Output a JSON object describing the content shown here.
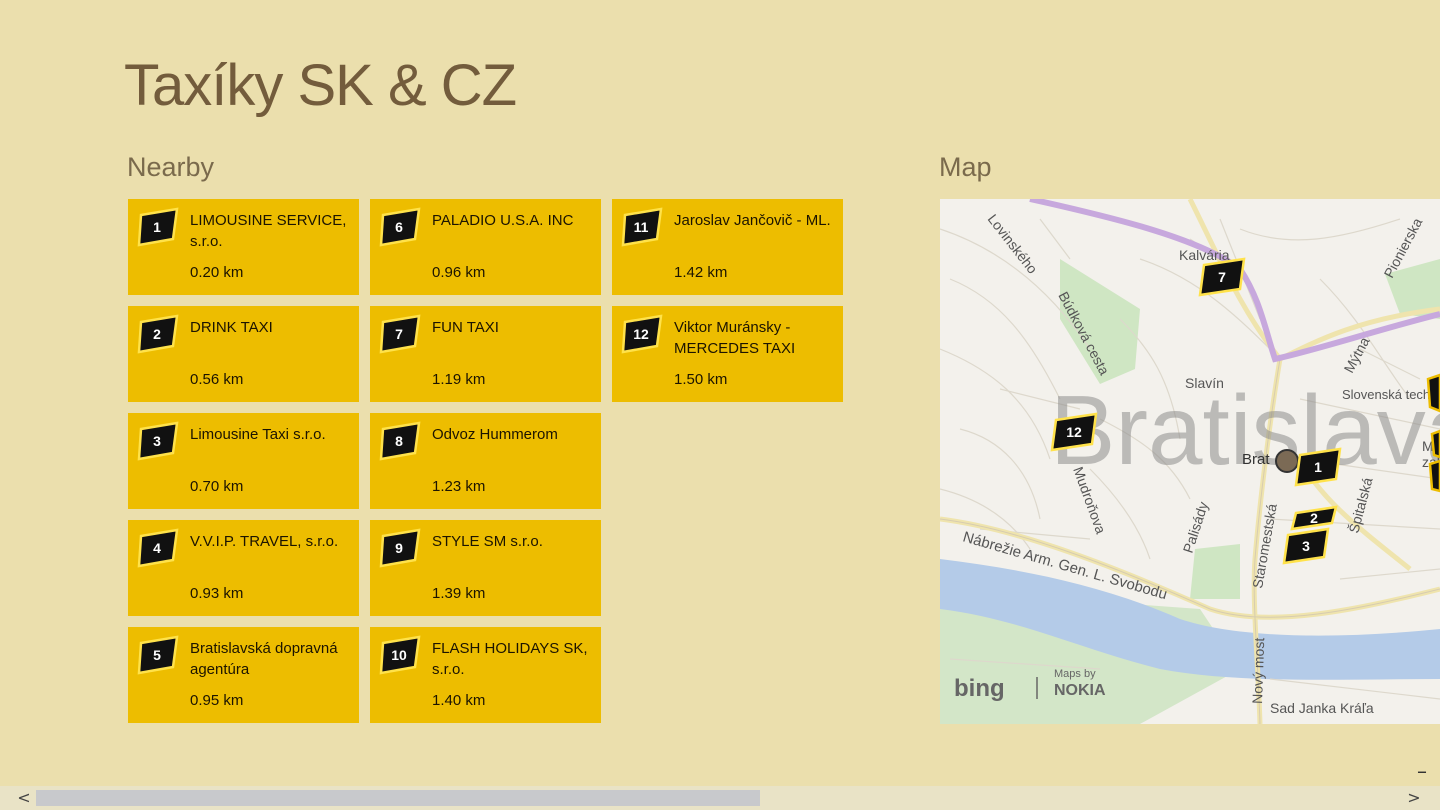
{
  "app": {
    "title": "Taxíky SK & CZ"
  },
  "sections": {
    "nearby": "Nearby",
    "map": "Map"
  },
  "taxis": [
    {
      "num": "1",
      "name": "LIMOUSINE SERVICE, s.r.o.",
      "distance": "0.20 km"
    },
    {
      "num": "2",
      "name": "DRINK TAXI",
      "distance": "0.56 km"
    },
    {
      "num": "3",
      "name": "Limousine Taxi s.r.o.",
      "distance": "0.70 km"
    },
    {
      "num": "4",
      "name": "V.V.I.P. TRAVEL, s.r.o.",
      "distance": "0.93 km"
    },
    {
      "num": "5",
      "name": "Bratislavská dopravná agentúra",
      "distance": "0.95 km"
    },
    {
      "num": "6",
      "name": "PALADIO U.S.A. INC",
      "distance": "0.96 km"
    },
    {
      "num": "7",
      "name": "FUN TAXI",
      "distance": "1.19 km"
    },
    {
      "num": "8",
      "name": "Odvoz Hummerom",
      "distance": "1.23 km"
    },
    {
      "num": "9",
      "name": "STYLE SM s.r.o.",
      "distance": "1.39 km"
    },
    {
      "num": "10",
      "name": "FLASH HOLIDAYS SK, s.r.o.",
      "distance": "1.40 km"
    },
    {
      "num": "11",
      "name": "Jaroslav Jančovič - ML.",
      "distance": "1.42 km"
    },
    {
      "num": "12",
      "name": "Viktor Muránsky - MERCEDES TAXI",
      "distance": "1.50 km"
    }
  ],
  "map": {
    "labels": {
      "city": "Bratislava",
      "kalvaria": "Kalvária",
      "lovinskeho": "Lovinského",
      "budkova": "Búdková cesta",
      "slavin": "Slavín",
      "mudronova": "Mudroňova",
      "palisady": "Palisády",
      "staromestska": "Staromestská",
      "spitalska": "Špitalská",
      "mytna": "Mýtna",
      "pionierska": "Pionierska",
      "stu": "Slovenská technická univerzita",
      "nabrezie": "Nábrežie Arm. Gen. L. Svobodu",
      "novy_most": "Nový most",
      "sad": "Sad Janka Kráľa",
      "brat": "Brat",
      "me": "Me",
      "zah": "zah"
    },
    "pins": [
      "7",
      "12",
      "1",
      "2",
      "3"
    ],
    "bing": "bing",
    "maps_by": "Maps by",
    "nokia": "NOKIA"
  },
  "controls": {
    "scroll_left": "<",
    "scroll_right": ">",
    "zoom_out": "–"
  },
  "colors": {
    "background": "#ebdfad",
    "tile": "#edbd00",
    "badge": "#111111",
    "title": "#735c3c"
  }
}
